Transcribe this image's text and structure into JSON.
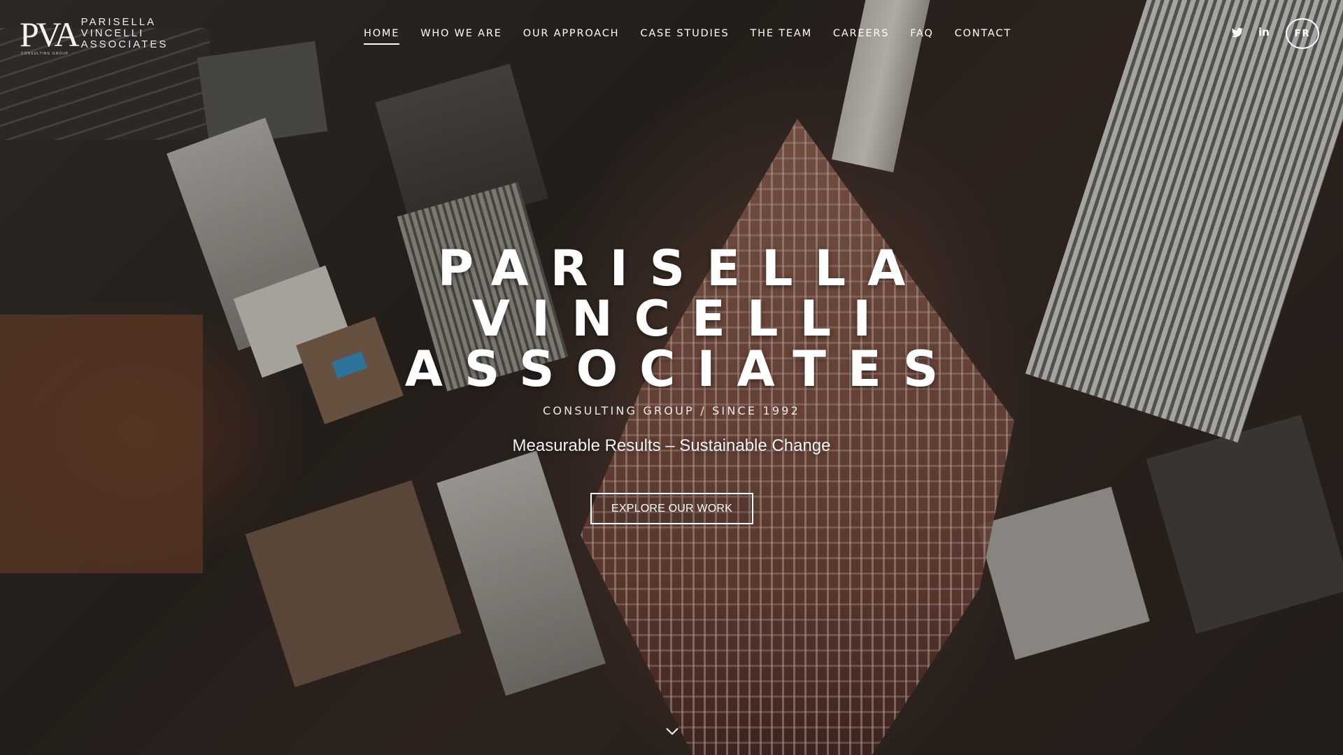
{
  "brand": {
    "logo_mark": "PVA",
    "logo_lines": [
      "PARISELLA",
      "VINCELLI",
      "ASSOCIATES"
    ],
    "logo_subtext": "CONSULTING GROUP"
  },
  "nav": {
    "items": [
      {
        "label": "HOME",
        "active": true
      },
      {
        "label": "WHO WE ARE",
        "active": false
      },
      {
        "label": "OUR APPROACH",
        "active": false
      },
      {
        "label": "CASE STUDIES",
        "active": false
      },
      {
        "label": "THE TEAM",
        "active": false
      },
      {
        "label": "CAREERS",
        "active": false
      },
      {
        "label": "FAQ",
        "active": false
      },
      {
        "label": "CONTACT",
        "active": false
      }
    ]
  },
  "social": {
    "twitter_icon": "twitter-icon",
    "linkedin_label": "in",
    "language_toggle": "FR"
  },
  "hero": {
    "title_lines": [
      "PARISELLA",
      "VINCELLI",
      "ASSOCIATES"
    ],
    "tagline": "CONSULTING GROUP / SINCE 1992",
    "slogan": "Measurable Results – Sustainable Change",
    "cta_label": "EXPLORE OUR WORK",
    "scroll_icon": "chevron-down-icon"
  },
  "colors": {
    "text": "#ffffff",
    "overlay": "#1a1612"
  }
}
